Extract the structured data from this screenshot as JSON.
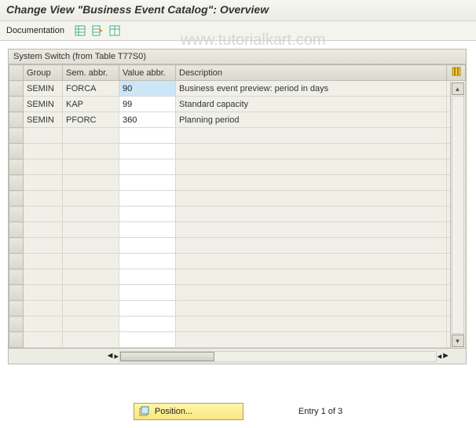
{
  "header": {
    "title": "Change View \"Business Event Catalog\": Overview"
  },
  "toolbar": {
    "documentation_label": "Documentation"
  },
  "watermark": "www.tutorialkart.com",
  "panel": {
    "title": "System Switch (from Table T77S0)",
    "columns": {
      "group": "Group",
      "sem": "Sem. abbr.",
      "val": "Value abbr.",
      "desc": "Description"
    },
    "rows": [
      {
        "group": "SEMIN",
        "sem": "FORCA",
        "val": "90",
        "desc": "Business event preview: period in days",
        "highlight": true
      },
      {
        "group": "SEMIN",
        "sem": "KAP",
        "val": "99",
        "desc": "Standard capacity"
      },
      {
        "group": "SEMIN",
        "sem": "PFORC",
        "val": "360",
        "desc": "Planning period"
      }
    ],
    "empty_rows": 14
  },
  "footer": {
    "position_label": "Position...",
    "entry_label": "Entry 1 of 3"
  }
}
